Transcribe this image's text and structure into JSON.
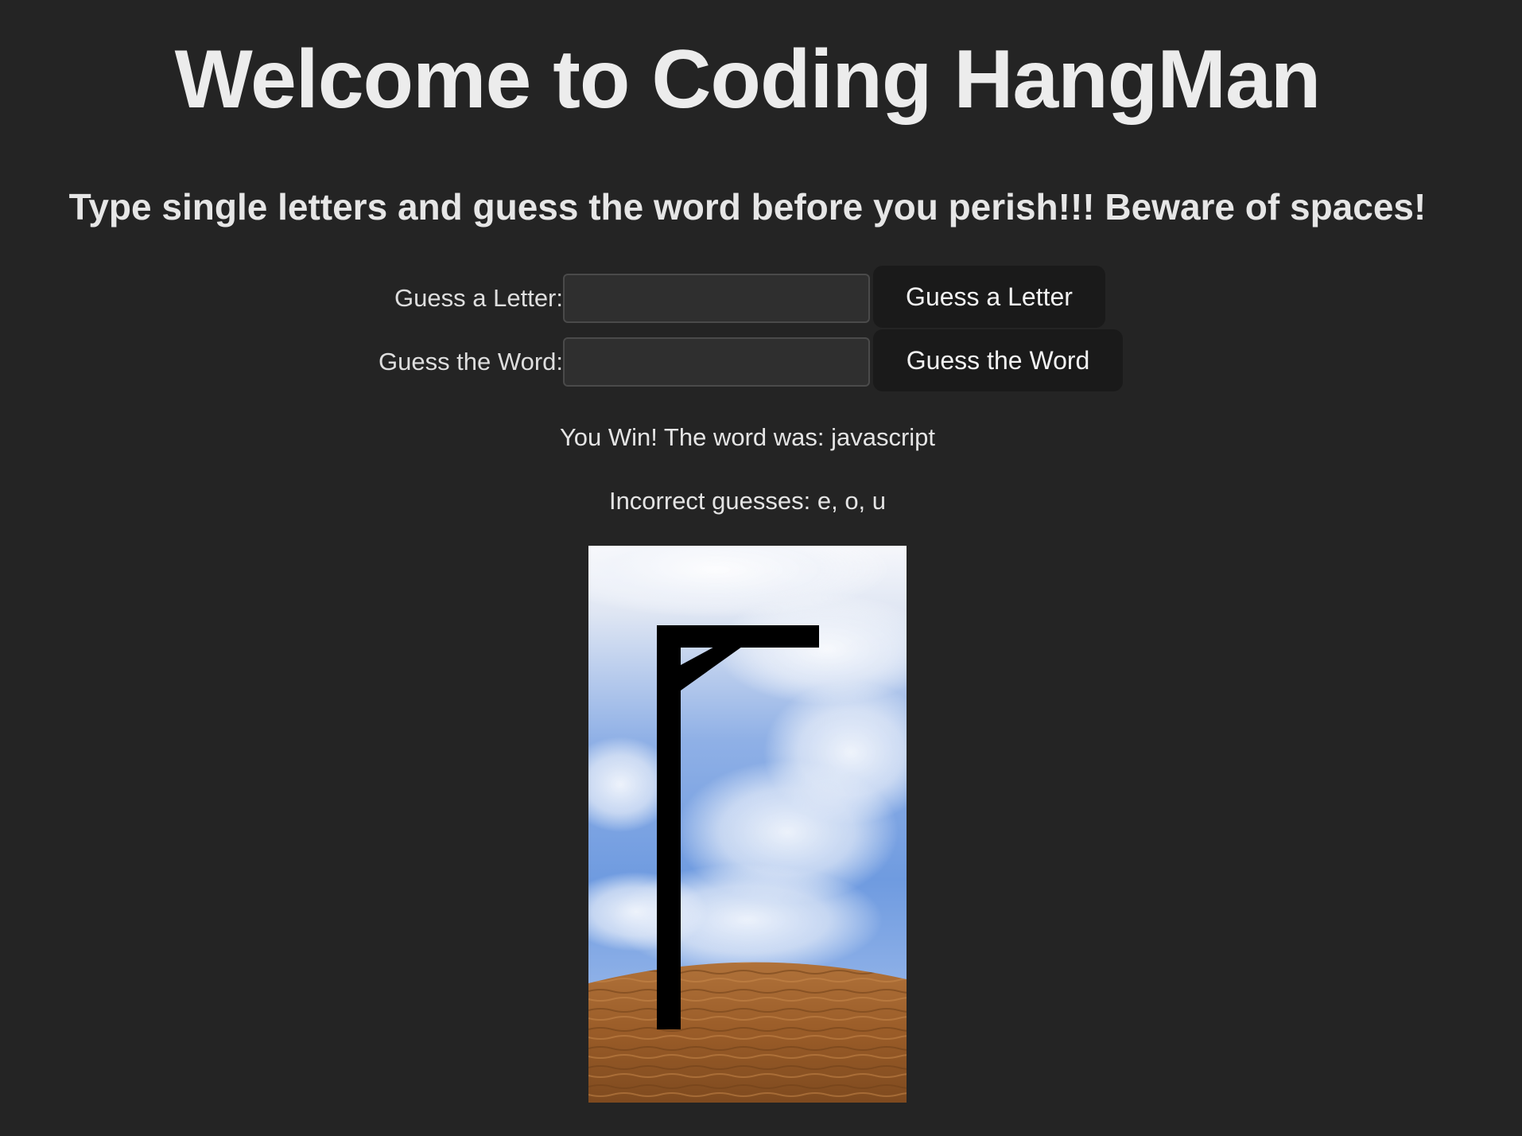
{
  "header": {
    "title": "Welcome to Coding HangMan",
    "subtitle": "Type single letters and guess the word before you perish!!! Beware of spaces!"
  },
  "letter_guess": {
    "label": "Guess a Letter:",
    "value": "",
    "button_label": "Guess a Letter"
  },
  "word_guess": {
    "label": "Guess the Word:",
    "value": "",
    "button_label": "Guess the Word"
  },
  "status": {
    "result_message": "You Win! The word was: javascript",
    "incorrect_guesses": "Incorrect guesses: e, o, u"
  },
  "game": {
    "word": "javascript",
    "outcome": "win",
    "incorrect_letters": [
      "e",
      "o",
      "u"
    ],
    "incorrect_count": 3
  },
  "colors": {
    "background": "#242424",
    "button": "#1a1a1a",
    "input": "#2f2f2f",
    "sky_top": "#f4f6fb",
    "sky_blue": "#6f9be0",
    "ground": "#a0602a",
    "gallows": "#000000"
  }
}
